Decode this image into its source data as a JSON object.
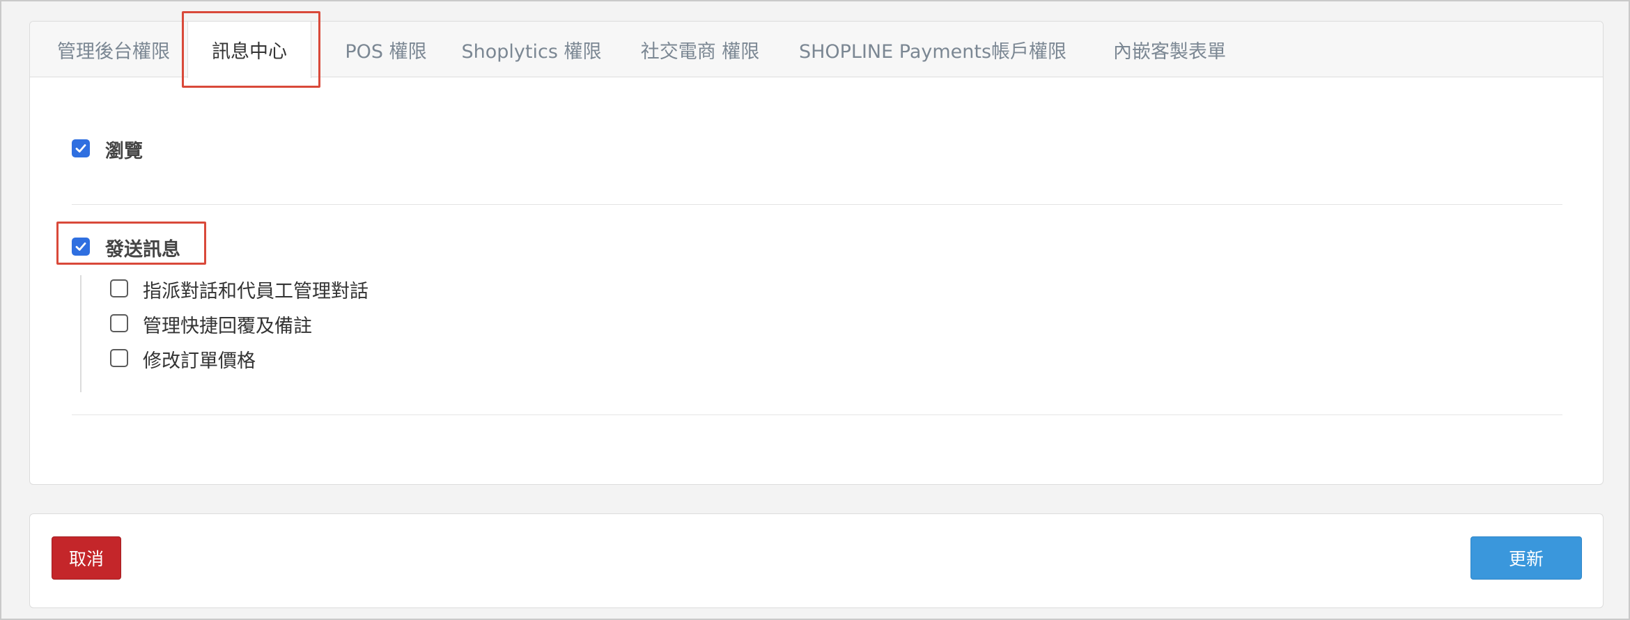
{
  "tabs": [
    {
      "label": "管理後台權限",
      "active": false
    },
    {
      "label": "訊息中心",
      "active": true
    },
    {
      "label": "POS 權限",
      "active": false
    },
    {
      "label": "Shoplytics 權限",
      "active": false
    },
    {
      "label": "社交電商 權限",
      "active": false
    },
    {
      "label": "SHOPLINE Payments帳戶權限",
      "active": false
    },
    {
      "label": "內嵌客製表單",
      "active": false
    }
  ],
  "permissions": {
    "browse": {
      "label": "瀏覽",
      "checked": true
    },
    "send_message": {
      "label": "發送訊息",
      "checked": true,
      "children": [
        {
          "label": "指派對話和代員工管理對話",
          "checked": false
        },
        {
          "label": "管理快捷回覆及備註",
          "checked": false
        },
        {
          "label": "修改訂單價格",
          "checked": false
        }
      ]
    }
  },
  "footer": {
    "cancel_label": "取消",
    "update_label": "更新"
  },
  "colors": {
    "checkbox_checked": "#2f6fe0",
    "highlight": "#d9493a",
    "cancel": "#c4262a",
    "update": "#3a97dc"
  }
}
